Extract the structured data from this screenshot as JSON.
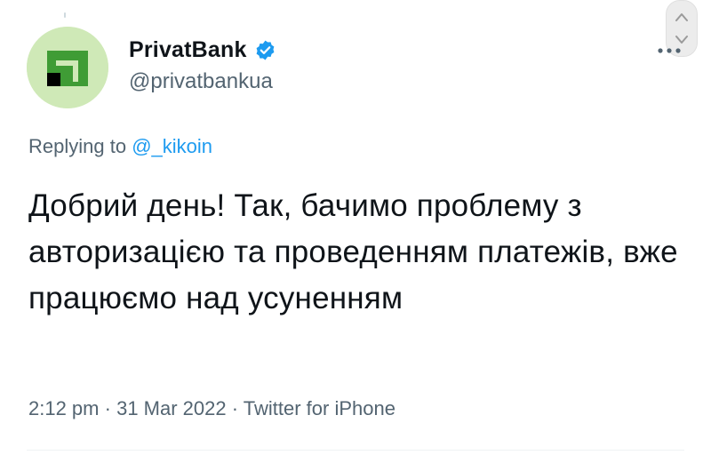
{
  "tweet": {
    "author": {
      "display_name": "PrivatBank",
      "handle": "@privatbankua",
      "verified": true,
      "avatar_icon": "privatbank-logo-icon"
    },
    "replying": {
      "prefix": "Replying to",
      "mention": "@_kikoin"
    },
    "text": "Добрий день! Так, бачимо проблему з авторизацією та проведенням платежів, вже працюємо над усуненням",
    "meta": {
      "time": "2:12 pm",
      "separator": "·",
      "date": "31 Mar 2022",
      "source": "Twitter for iPhone"
    }
  },
  "colors": {
    "text": "#0f1419",
    "secondary": "#536471",
    "link": "#1d9bf0",
    "verified": "#1d9bf0",
    "avatar_bg": "#cfe9b7",
    "brand_green": "#3f9c35"
  },
  "icons": {
    "verified": "verified-badge-icon",
    "more": "more-options-icon",
    "scroll": "scroll-control-icon"
  }
}
